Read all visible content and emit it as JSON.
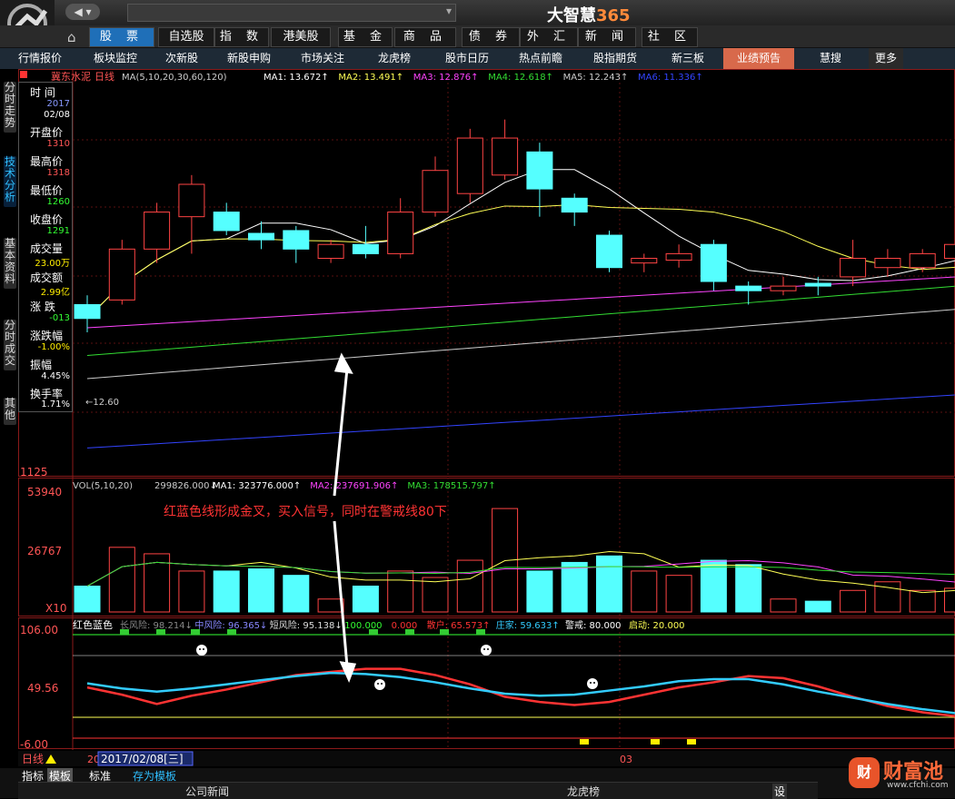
{
  "app": {
    "brand": "大智慧",
    "brand_num": "365"
  },
  "menu": {
    "items": [
      "股 票",
      "自选股",
      "指 数",
      "港美股",
      "基 金",
      "商 品",
      "债 券",
      "外 汇",
      "新 闻",
      "社 区"
    ]
  },
  "tabs": [
    "行情报价",
    "板块监控",
    "次新股",
    "新股申购",
    "市场关注",
    "龙虎榜",
    "股市日历",
    "热点前瞻",
    "股指期货",
    "新三板",
    "业绩预告",
    "慧搜",
    "更多"
  ],
  "left_tabs": [
    "分时走势",
    "技术分析",
    "基本资料",
    "分时成交",
    "其他"
  ],
  "stock": {
    "name": "冀东水泥",
    "period": "日线"
  },
  "ma_legend": {
    "prefix": "MA(5,10,20,30,60,120)",
    "items": [
      {
        "label": "MA1: 13.672↑",
        "color": "#ffffff"
      },
      {
        "label": "MA2: 13.491↑",
        "color": "#ffff55"
      },
      {
        "label": "MA3: 12.876↑",
        "color": "#ff44ff"
      },
      {
        "label": "MA4: 12.618↑",
        "color": "#33dd33"
      },
      {
        "label": "MA5: 12.243↑",
        "color": "#cccccc"
      },
      {
        "label": "MA6: 11.336↑",
        "color": "#3344ff"
      }
    ]
  },
  "info": {
    "time_label": "时 间",
    "date_year": "2017",
    "date_md": "02/08",
    "open_label": "开盘价",
    "open": "1310",
    "high_label": "最高价",
    "high": "1318",
    "low_label": "最低价",
    "low": "1260",
    "close_label": "收盘价",
    "close": "1291",
    "vol_label": "成交量",
    "vol": "23.00万",
    "amt_label": "成交额",
    "amt": "2.99亿",
    "chg_label": "涨 跌",
    "chg": "-013",
    "pct_label": "涨跌幅",
    "pct": "-1.00%",
    "amp_label": "振幅",
    "amp": "4.45%",
    "turn_label": "换手率",
    "turn": "1.71%"
  },
  "price_axis": {
    "bottom": "1125",
    "low_mark": "←12.60"
  },
  "vol_legend": {
    "prefix": "VOL(5,10,20)",
    "value": "299826.000↓",
    "items": [
      {
        "label": "MA1: 323776.000↑",
        "color": "#ffffff"
      },
      {
        "label": "MA2: 237691.906↑",
        "color": "#ff44ff"
      },
      {
        "label": "MA3: 178515.797↑",
        "color": "#33dd33"
      }
    ],
    "axis_top": "53940",
    "axis_mid": "26767",
    "axis_unit": "X10"
  },
  "annotation": "红蓝色线形成金叉，买入信号，同时在警戒线80下",
  "ind_legend": {
    "name": "红色蓝色",
    "items": [
      {
        "label": "长风险: 98.214↓",
        "color": "#888888"
      },
      {
        "label": "中风险: 96.365↓",
        "color": "#8888ff"
      },
      {
        "label": "短风险: 95.138↓",
        "color": "#dddddd"
      },
      {
        "label": "100.000",
        "color": "#33ff33"
      },
      {
        "label": "0.000",
        "color": "#ff3333"
      },
      {
        "label": "散户: 65.573↑",
        "color": "#ff3333"
      },
      {
        "label": "庄家: 59.633↑",
        "color": "#33ccff"
      },
      {
        "label": "警戒: 80.000",
        "color": "#ffffff"
      },
      {
        "label": "启动: 20.000",
        "color": "#ffff55"
      }
    ],
    "axis_top": "106.00",
    "axis_mid": "49.56",
    "axis_bottom": "-6.00"
  },
  "date_bar": {
    "period": "日线",
    "date": "2017/02/08[三]",
    "month": "03",
    "prefix": "20"
  },
  "bottom": {
    "tab1": "指标",
    "tab2": "模板",
    "tab3": "标准",
    "tab4": "存为模板",
    "news1": "公司新闻",
    "news2": "龙虎榜",
    "settings": "设"
  },
  "watermark": {
    "text": "财富池",
    "url": "www.cfchi.com"
  },
  "chart_data": {
    "type": "candlestick",
    "candles": [
      {
        "o": 12.85,
        "c": 12.7,
        "h": 12.95,
        "l": 12.55
      },
      {
        "o": 12.9,
        "c": 13.45,
        "h": 13.55,
        "l": 12.85
      },
      {
        "o": 13.45,
        "c": 13.85,
        "h": 13.95,
        "l": 13.3
      },
      {
        "o": 13.8,
        "c": 14.15,
        "h": 14.25,
        "l": 13.4
      },
      {
        "o": 13.85,
        "c": 13.65,
        "h": 13.95,
        "l": 13.6
      },
      {
        "o": 13.62,
        "c": 13.55,
        "h": 13.75,
        "l": 13.45
      },
      {
        "o": 13.65,
        "c": 13.45,
        "h": 13.7,
        "l": 13.3
      },
      {
        "o": 13.35,
        "c": 13.5,
        "h": 13.55,
        "l": 13.3
      },
      {
        "o": 13.5,
        "c": 13.4,
        "h": 13.7,
        "l": 13.35
      },
      {
        "o": 13.4,
        "c": 13.85,
        "h": 14.0,
        "l": 13.35
      },
      {
        "o": 13.85,
        "c": 14.3,
        "h": 14.45,
        "l": 13.8
      },
      {
        "o": 14.05,
        "c": 14.65,
        "h": 14.75,
        "l": 13.95
      },
      {
        "o": 14.25,
        "c": 14.65,
        "h": 14.85,
        "l": 14.2
      },
      {
        "o": 14.5,
        "c": 14.1,
        "h": 14.6,
        "l": 13.8
      },
      {
        "o": 14.0,
        "c": 13.85,
        "h": 14.05,
        "l": 13.7
      },
      {
        "o": 13.6,
        "c": 13.25,
        "h": 13.65,
        "l": 13.2
      },
      {
        "o": 13.3,
        "c": 13.35,
        "h": 13.4,
        "l": 13.2
      },
      {
        "o": 13.33,
        "c": 13.4,
        "h": 13.5,
        "l": 13.25
      },
      {
        "o": 13.5,
        "c": 13.1,
        "h": 13.55,
        "l": 13.0
      },
      {
        "o": 13.05,
        "c": 13.0,
        "h": 13.1,
        "l": 12.85
      },
      {
        "o": 13.0,
        "c": 13.05,
        "h": 13.15,
        "l": 12.95
      },
      {
        "o": 13.08,
        "c": 13.05,
        "h": 13.15,
        "l": 12.95
      },
      {
        "o": 13.15,
        "c": 13.35,
        "h": 13.55,
        "l": 13.05
      },
      {
        "o": 13.25,
        "c": 13.35,
        "h": 13.45,
        "l": 13.15
      },
      {
        "o": 13.25,
        "c": 13.4,
        "h": 13.45,
        "l": 13.2
      },
      {
        "o": 13.35,
        "c": 13.5,
        "h": 13.65,
        "l": 13.25
      },
      {
        "o": 13.45,
        "c": 13.75,
        "h": 13.9,
        "l": 13.4
      }
    ],
    "volumes": [
      12000,
      30000,
      27000,
      19000,
      19000,
      20000,
      17000,
      6000,
      12000,
      19000,
      16000,
      24000,
      48000,
      19000,
      23000,
      26000,
      19000,
      17000,
      24000,
      22000,
      6000,
      5000,
      10000,
      14000,
      10000,
      11000,
      13000
    ],
    "ind_red": [
      49,
      42,
      33,
      41,
      47,
      54,
      61,
      64,
      67,
      67,
      61,
      52,
      40,
      35,
      32,
      35,
      42,
      49,
      54,
      60,
      58,
      50,
      40,
      31,
      25,
      21,
      20
    ],
    "ind_blue": [
      53,
      48,
      45,
      48,
      52,
      56,
      60,
      63,
      62,
      59,
      54,
      48,
      43,
      41,
      42,
      46,
      50,
      55,
      57,
      57,
      52,
      45,
      39,
      33,
      28,
      24,
      22
    ]
  }
}
